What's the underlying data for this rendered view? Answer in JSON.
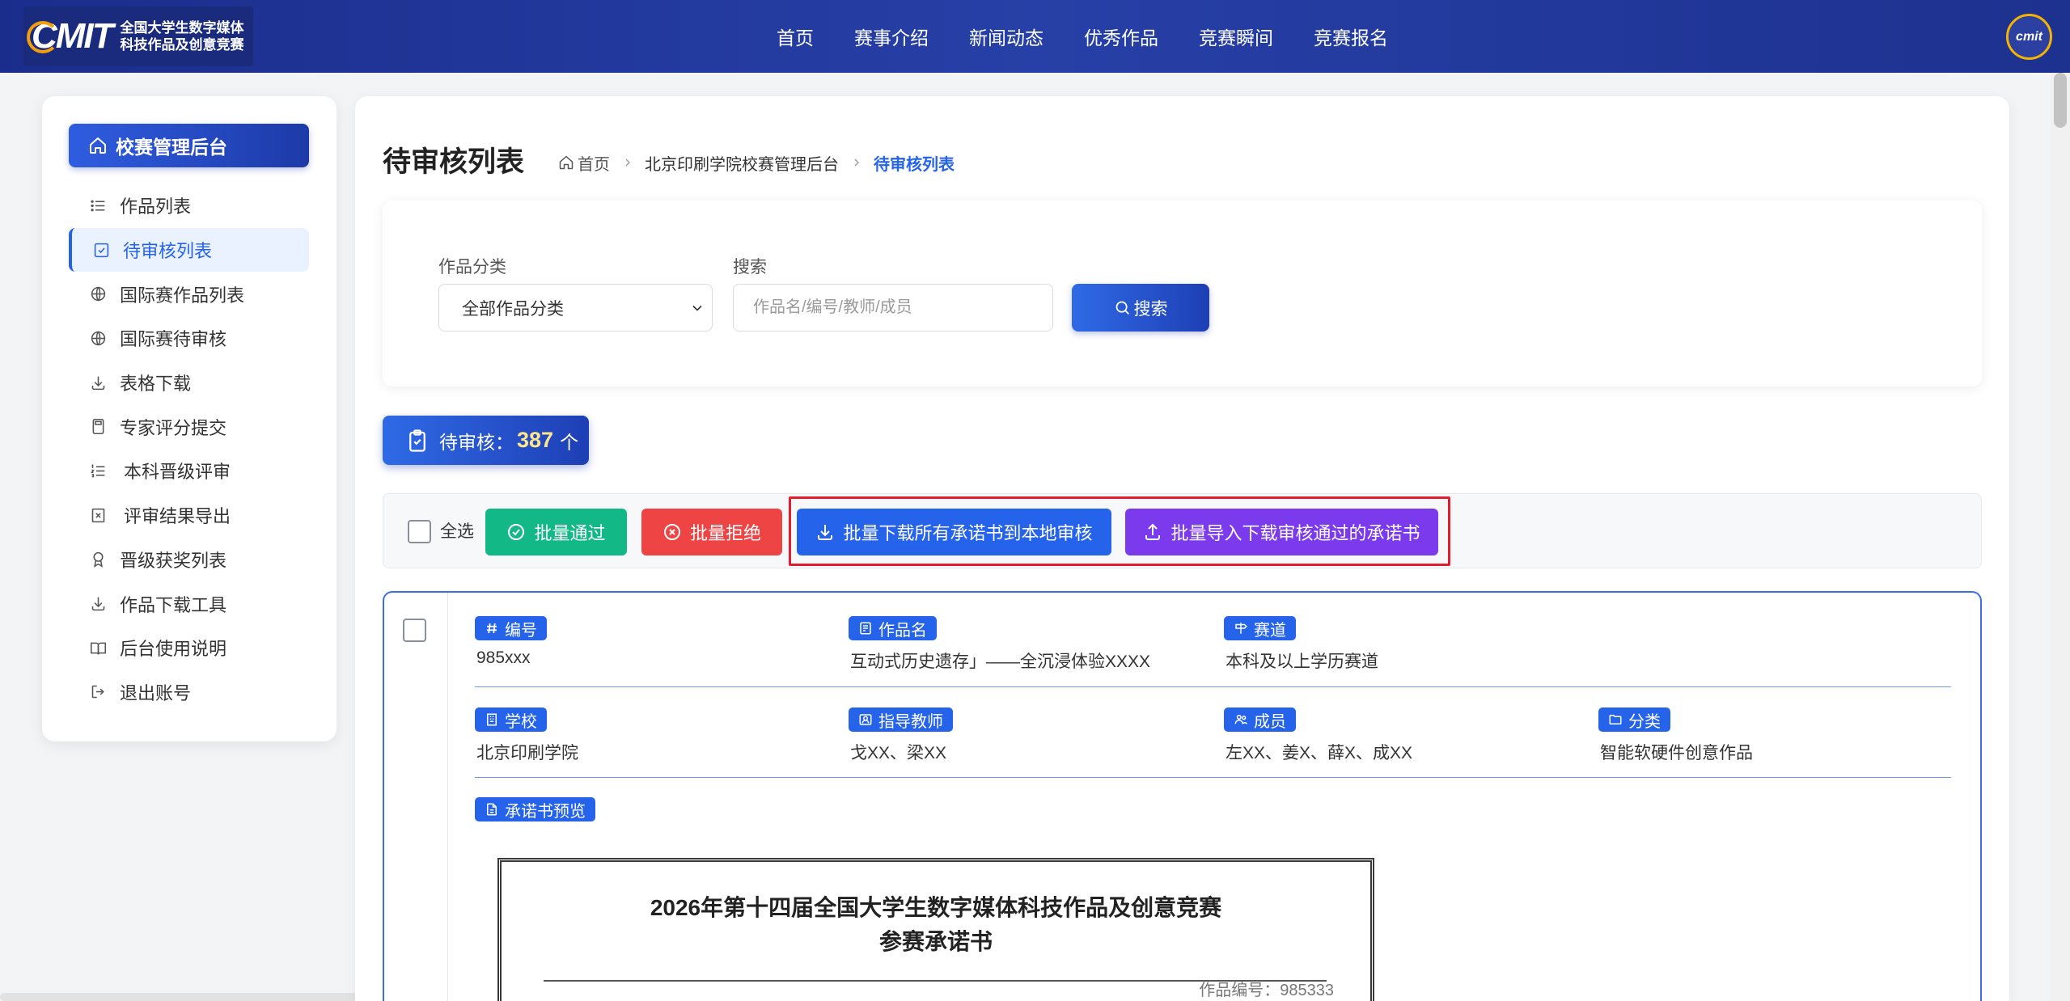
{
  "header": {
    "logo_text": "CMIT",
    "logo_line1": "全国大学生数字媒体",
    "logo_line2": "科技作品及创意竞赛",
    "nav": [
      "首页",
      "赛事介绍",
      "新闻动态",
      "优秀作品",
      "竞赛瞬间",
      "竞赛报名"
    ],
    "avatar_text": "cmit"
  },
  "sidebar": {
    "title": "校赛管理后台",
    "title_icon": "home-icon",
    "items": [
      {
        "label": "作品列表",
        "icon": "list-icon"
      },
      {
        "label": "待审核列表",
        "icon": "check-square-icon",
        "active": true
      },
      {
        "label": "国际赛作品列表",
        "icon": "globe-icon"
      },
      {
        "label": "国际赛待审核",
        "icon": "globe-icon"
      },
      {
        "label": "表格下载",
        "icon": "download-icon"
      },
      {
        "label": "专家评分提交",
        "icon": "calculator-icon"
      },
      {
        "label": "本科晋级评审",
        "icon": "ordered-list-icon"
      },
      {
        "label": "评审结果导出",
        "icon": "file-x-icon"
      },
      {
        "label": "晋级获奖列表",
        "icon": "award-icon"
      },
      {
        "label": "作品下载工具",
        "icon": "download-icon"
      },
      {
        "label": "后台使用说明",
        "icon": "book-icon"
      },
      {
        "label": "退出账号",
        "icon": "logout-icon"
      }
    ]
  },
  "page": {
    "title": "待审核列表",
    "breadcrumb": [
      {
        "label": "首页",
        "icon": "home-icon"
      },
      {
        "label": "北京印刷学院校赛管理后台"
      },
      {
        "label": "待审核列表"
      }
    ]
  },
  "filter": {
    "category_label": "作品分类",
    "category_value": "全部作品分类",
    "search_label": "搜索",
    "search_placeholder": "作品名/编号/教师/成员",
    "search_button": "搜索"
  },
  "pending": {
    "label": "待审核：",
    "count": "387",
    "unit": "个"
  },
  "toolbar": {
    "select_all": "全选",
    "approve": "批量通过",
    "reject": "批量拒绝",
    "download_all": "批量下载所有承诺书到本地审核",
    "import_approved": "批量导入下载审核通过的承诺书"
  },
  "submission": {
    "row1": [
      {
        "label": "编号",
        "icon": "hash-icon",
        "value": "985xxx"
      },
      {
        "label": "作品名",
        "icon": "file-text-icon",
        "value": "互动式历史遗存」——全沉浸体验XXXX"
      },
      {
        "label": "赛道",
        "icon": "signpost-icon",
        "value": "本科及以上学历赛道"
      }
    ],
    "row2": [
      {
        "label": "学校",
        "icon": "building-icon",
        "value": "北京印刷学院"
      },
      {
        "label": "指导教师",
        "icon": "teacher-icon",
        "value": "戈XX、梁XX"
      },
      {
        "label": "成员",
        "icon": "users-icon",
        "value": "左XX、姜X、薛X、成XX"
      },
      {
        "label": "分类",
        "icon": "folder-icon",
        "value": "智能软硬件创意作品"
      }
    ],
    "preview_label": "承诺书预览",
    "preview": {
      "title_line1": "2026年第十四届全国大学生数字媒体科技作品及创意竞赛",
      "title_line2": "参赛承诺书",
      "code_label": "作品编号：",
      "code_value": "985333"
    }
  },
  "colors": {
    "header_bg": "#22399c",
    "primary": "#2563eb",
    "success": "#10b981",
    "danger": "#ef4444",
    "purple": "#7c3aed",
    "highlight_border": "#e11d2e",
    "count_color": "#fde68a"
  }
}
